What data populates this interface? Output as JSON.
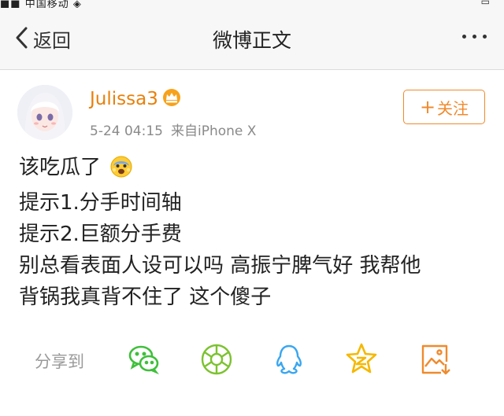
{
  "status_bar": {
    "left_text": "■■ 中国移动 ◈",
    "right_text": "▭"
  },
  "nav": {
    "back_label": "返回",
    "title": "微博正文"
  },
  "author": {
    "name": "Julissa3",
    "time": "5-24 04:15",
    "source": "来自iPhone X"
  },
  "follow_button": {
    "plus": "+",
    "label": "关注"
  },
  "post": {
    "lines": [
      "该吃瓜了",
      "提示1.分手时间轴",
      "提示2.巨额分手费",
      "别总看表面人设可以吗 高振宁脾气好 我帮他",
      "背锅我真背不住了 这个傻子"
    ],
    "emoji": "scared-face-emoji"
  },
  "share": {
    "label": "分享到",
    "targets": [
      "wechat-icon",
      "moments-icon",
      "qq-icon",
      "qzone-icon",
      "save-image-icon"
    ],
    "colors": {
      "wechat": "#3fbf3b",
      "moments": "#7cc22f",
      "qq": "#3aa6f0",
      "qzone": "#f5b800",
      "save": "#f08a2c"
    }
  },
  "colors": {
    "accent": "#f08a2c",
    "username": "#e8800b",
    "meta": "#8a8a8a",
    "nav_bg": "#f7f7f7"
  }
}
